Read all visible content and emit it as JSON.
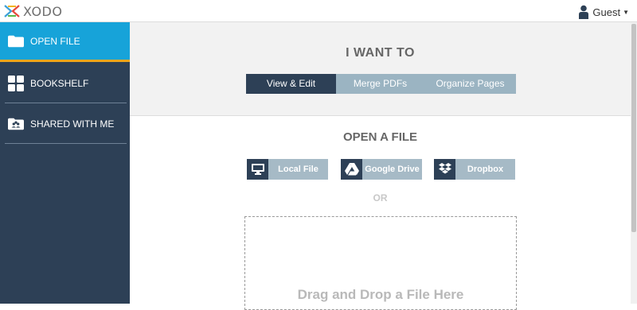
{
  "header": {
    "logo_text": "XODO",
    "user_label": "Guest",
    "user_icon": "person-icon",
    "dropdown_icon": "caret-down-icon"
  },
  "sidebar": {
    "items": [
      {
        "label": "OPEN FILE",
        "icon": "folder-icon",
        "active": true
      },
      {
        "label": "BOOKSHELF",
        "icon": "grid-icon",
        "active": false
      },
      {
        "label": "SHARED WITH ME",
        "icon": "shared-folder-icon",
        "active": false
      }
    ]
  },
  "main": {
    "i_want_to": "I WANT TO",
    "modes": [
      {
        "label": "View & Edit",
        "active": true
      },
      {
        "label": "Merge PDFs",
        "active": false
      },
      {
        "label": "Organize Pages",
        "active": false
      }
    ],
    "open_a_file": "OPEN A FILE",
    "sources": [
      {
        "label": "Local File",
        "icon": "monitor-icon"
      },
      {
        "label": "Google Drive",
        "icon": "google-drive-icon"
      },
      {
        "label": "Dropbox",
        "icon": "dropbox-icon"
      }
    ],
    "or_label": "OR",
    "drop_text": "Drag and Drop a File Here"
  },
  "colors": {
    "sidebar_bg": "#2d4056",
    "active_item": "#17a3d9",
    "active_underline": "#f0a51b",
    "button_inactive": "#9bb4c2"
  }
}
